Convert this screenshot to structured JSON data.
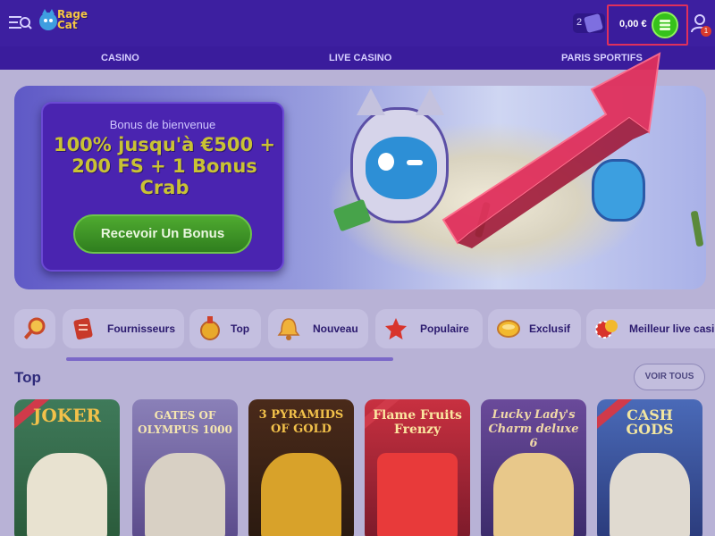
{
  "header": {
    "logo_text": "Rage Cat",
    "free_spins_count": "2",
    "balance": "0,00 €",
    "notification_count": "1"
  },
  "nav": {
    "items": [
      {
        "label": "CASINO"
      },
      {
        "label": "LIVE CASINO"
      },
      {
        "label": "PARIS SPORTIFS"
      }
    ]
  },
  "banner": {
    "subtitle": "Bonus de bienvenue",
    "title": "100% jusqu'à €500 + 200 FS + 1 Bonus Crab",
    "cta": "Recevoir Un Bonus"
  },
  "categories": [
    {
      "label": "",
      "icon": "search-icon"
    },
    {
      "label": "Fournisseurs",
      "icon": "provider-icon"
    },
    {
      "label": "Top",
      "icon": "top-icon"
    },
    {
      "label": "Nouveau",
      "icon": "bell-icon"
    },
    {
      "label": "Populaire",
      "icon": "star-icon"
    },
    {
      "label": "Exclusif",
      "icon": "exclusive-icon"
    },
    {
      "label": "Meilleur live casino",
      "icon": "live-icon"
    }
  ],
  "top_section": {
    "title": "Top",
    "see_all": "VOIR TOUS"
  },
  "games": [
    {
      "name": "JOKER",
      "color": "#4a8a2a"
    },
    {
      "name": "GATES OF OLYMPUS 1000",
      "color": "#8a78b6"
    },
    {
      "name": "3 PYRAMIDS OF GOLD",
      "color": "#5a2a1a"
    },
    {
      "name": "Flame Fruits Frenzy",
      "color": "#b82a3a"
    },
    {
      "name": "Lucky Lady's Charm deluxe 6",
      "color": "#5a3a8a"
    },
    {
      "name": "CASH GODS",
      "color": "#3a5aa8"
    }
  ],
  "colors": {
    "header_bg": "#3d1fa0",
    "highlight_border": "#e0305c",
    "arrow": "#e0305c",
    "coin_green": "#36c21b"
  }
}
